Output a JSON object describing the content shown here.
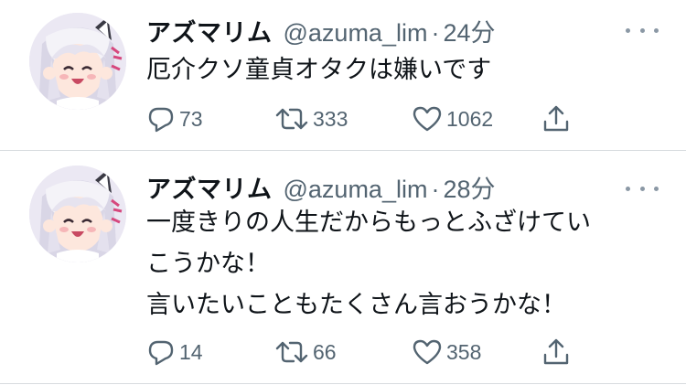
{
  "tweets": [
    {
      "display_name": "アズマリム",
      "handle": "@azuma_lim",
      "separator": "·",
      "time": "24分",
      "lines": [
        "厄介クソ童貞オタクは嫌いです"
      ],
      "reply_count": "73",
      "retweet_count": "333",
      "like_count": "1062",
      "avatar": "anime-girl-avatar"
    },
    {
      "display_name": "アズマリム",
      "handle": "@azuma_lim",
      "separator": "·",
      "time": "28分",
      "lines": [
        "一度きりの人生だからもっとふざけてい",
        "こうかな！",
        "言いたいこともたくさん言おうかな！"
      ],
      "reply_count": "14",
      "retweet_count": "66",
      "like_count": "358",
      "avatar": "anime-girl-avatar"
    }
  ],
  "icons": {
    "reply": "reply-icon",
    "retweet": "retweet-icon",
    "like": "heart-icon",
    "share": "share-icon",
    "more": "more-icon"
  },
  "colors": {
    "text": "#0f1419",
    "secondary": "#536471",
    "divider": "#d7dbdf"
  }
}
